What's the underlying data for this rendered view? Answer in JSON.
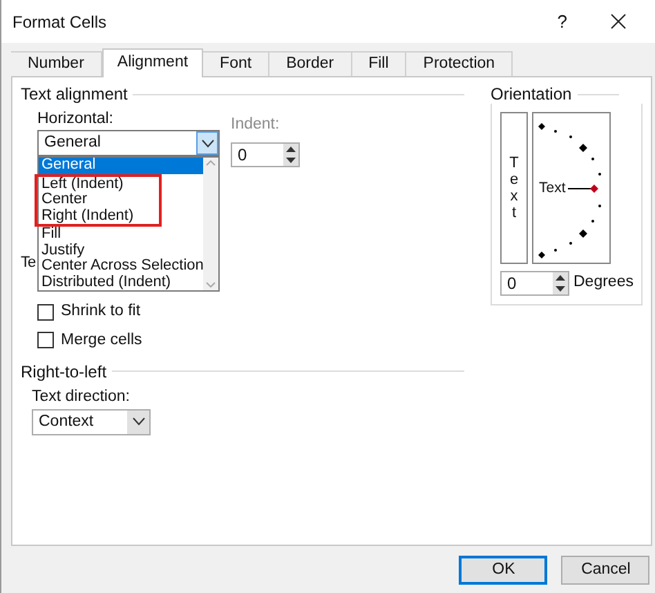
{
  "window": {
    "title": "Format Cells",
    "help": "?"
  },
  "tabs": [
    {
      "label": "Number",
      "selected": false
    },
    {
      "label": "Alignment",
      "selected": true
    },
    {
      "label": "Font",
      "selected": false
    },
    {
      "label": "Border",
      "selected": false
    },
    {
      "label": "Fill",
      "selected": false
    },
    {
      "label": "Protection",
      "selected": false
    }
  ],
  "text_alignment": {
    "title": "Text alignment",
    "horizontal": {
      "label": "Horizontal:",
      "value": "General",
      "expanded": true,
      "options": [
        {
          "label": "General",
          "selected": true
        },
        {
          "label": "Left (Indent)",
          "selected": false
        },
        {
          "label": "Center",
          "selected": false
        },
        {
          "label": "Right (Indent)",
          "selected": false
        },
        {
          "label": "Fill",
          "selected": false
        },
        {
          "label": "Justify",
          "selected": false
        },
        {
          "label": "Center Across Selection",
          "selected": false
        },
        {
          "label": "Distributed (Indent)",
          "selected": false
        }
      ]
    },
    "indent": {
      "label": "Indent:",
      "value": "0"
    }
  },
  "text_control": {
    "title": "Te",
    "checkboxes": [
      {
        "label": "Shrink to fit",
        "checked": false
      },
      {
        "label": "Merge cells",
        "checked": false
      }
    ]
  },
  "right_to_left": {
    "title": "Right-to-left",
    "text_direction": {
      "label": "Text direction:",
      "value": "Context"
    }
  },
  "orientation": {
    "title": "Orientation",
    "vertical_text": "Text",
    "dial_text": "Text",
    "degrees": {
      "value": "0",
      "label": "Degrees"
    }
  },
  "buttons": [
    {
      "label": "OK",
      "default": true
    },
    {
      "label": "Cancel",
      "default": false
    }
  ]
}
